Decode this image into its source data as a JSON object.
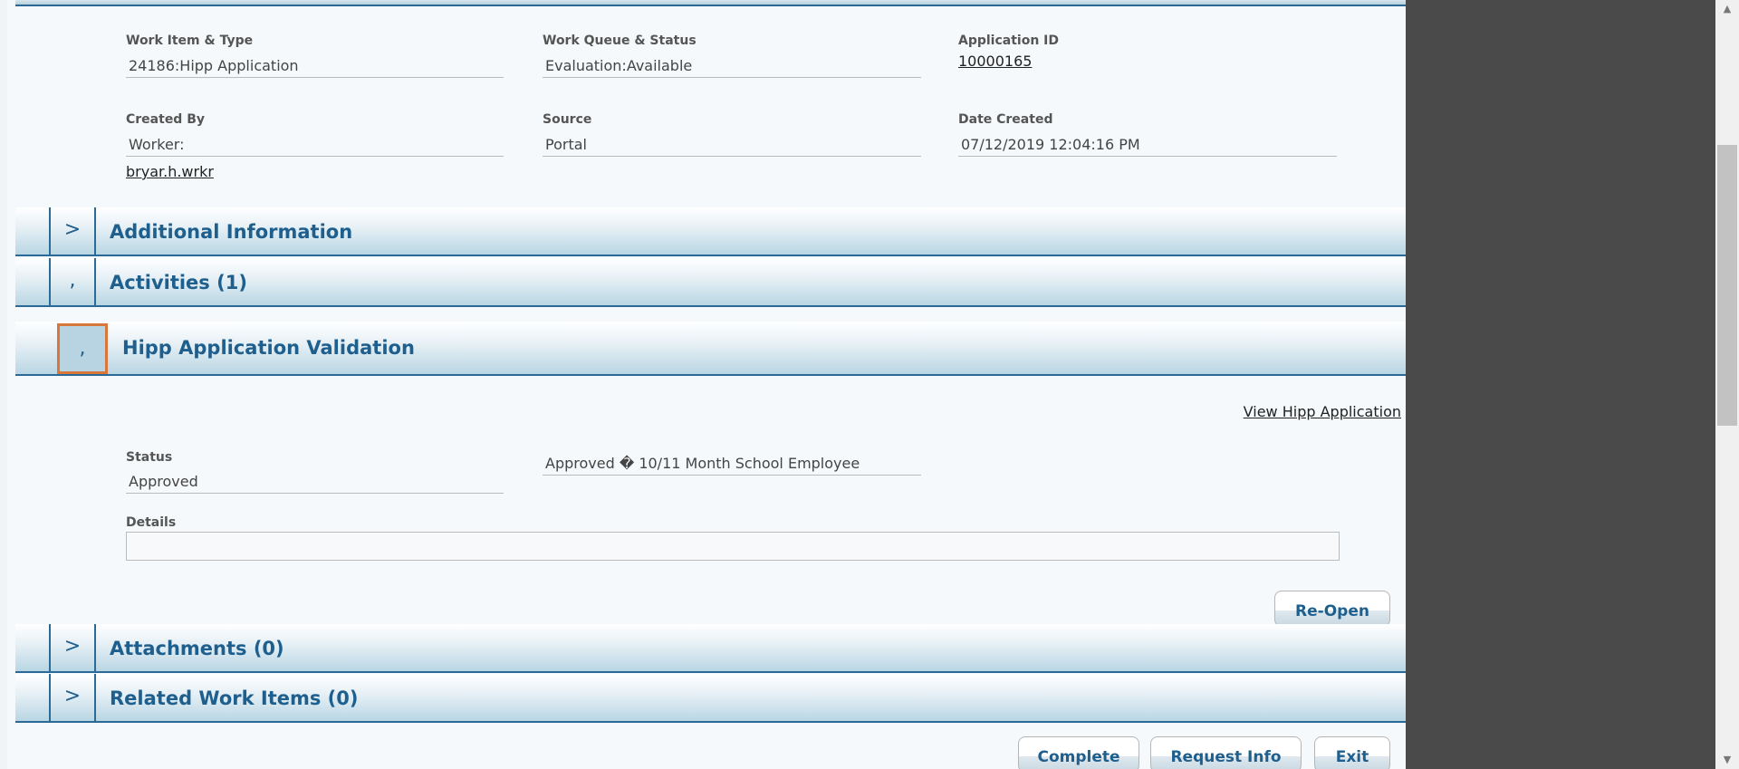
{
  "summary": {
    "work_item_label": "Work Item & Type",
    "work_item_value": "24186:Hipp Application",
    "work_queue_label": "Work Queue & Status",
    "work_queue_value": "Evaluation:Available",
    "application_id_label": "Application ID",
    "application_id_value": "10000165",
    "created_by_label": "Created By",
    "created_by_value": "Worker:",
    "created_by_link": "bryar.h.wrkr",
    "source_label": "Source",
    "source_value": "Portal",
    "date_created_label": "Date Created",
    "date_created_value": "07/12/2019 12:04:16 PM"
  },
  "sections": {
    "additional_information": {
      "toggle": ">",
      "title": "Additional Information"
    },
    "activities": {
      "toggle": ",",
      "title": "Activities (1)"
    },
    "hipp_validation": {
      "toggle": ",",
      "title": "Hipp Application Validation"
    },
    "attachments": {
      "toggle": ">",
      "title": "Attachments (0)"
    },
    "related_work_items": {
      "toggle": ">",
      "title": "Related Work Items (0)"
    }
  },
  "validation": {
    "view_link": "View Hipp Application",
    "status_label": "Status",
    "status_value": "Approved",
    "status_reason": "Approved � 10/11 Month School Employee",
    "details_label": "Details",
    "details_value": "",
    "reopen_button": "Re-Open"
  },
  "footer": {
    "complete_button": "Complete",
    "request_info_button": "Request Info",
    "exit_button": "Exit"
  },
  "scrollbar": {
    "up_icon": "▲",
    "down_icon": "▼"
  }
}
